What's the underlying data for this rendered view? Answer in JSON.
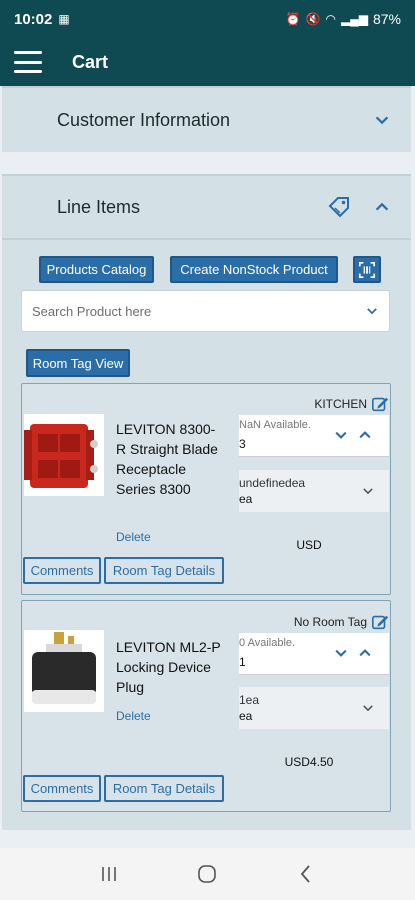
{
  "status": {
    "time": "10:02",
    "battery": "87%"
  },
  "appbar": {
    "title": "Cart"
  },
  "customer_section": {
    "title": "Customer Information"
  },
  "line_items": {
    "title": "Line Items",
    "buttons": {
      "catalog": "Products Catalog",
      "nonstock": "Create NonStock Product",
      "roomtag_view": "Room Tag View"
    },
    "search_placeholder": "Search Product here",
    "items": [
      {
        "room_tag": "KITCHEN",
        "name": "LEVITON 8300-R Straight Blade Receptacle Series 8300",
        "delete": "Delete",
        "available": "NaN Available.",
        "qty": "3",
        "uom_line1": "undefinedea",
        "uom_line2": "ea",
        "price": "USD",
        "comments": "Comments",
        "room_tag_details": "Room Tag Details"
      },
      {
        "room_tag": "No Room Tag",
        "name": "LEVITON ML2-P Locking Device Plug",
        "delete": "Delete",
        "available": "0 Available.",
        "qty": "1",
        "uom_line1": "1ea",
        "uom_line2": "ea",
        "price": "USD4.50",
        "comments": "Comments",
        "room_tag_details": "Room Tag Details"
      }
    ]
  },
  "colors": {
    "appbar": "#0f4a52",
    "accent": "#2b6ea7",
    "panel": "#d3e0e6"
  }
}
